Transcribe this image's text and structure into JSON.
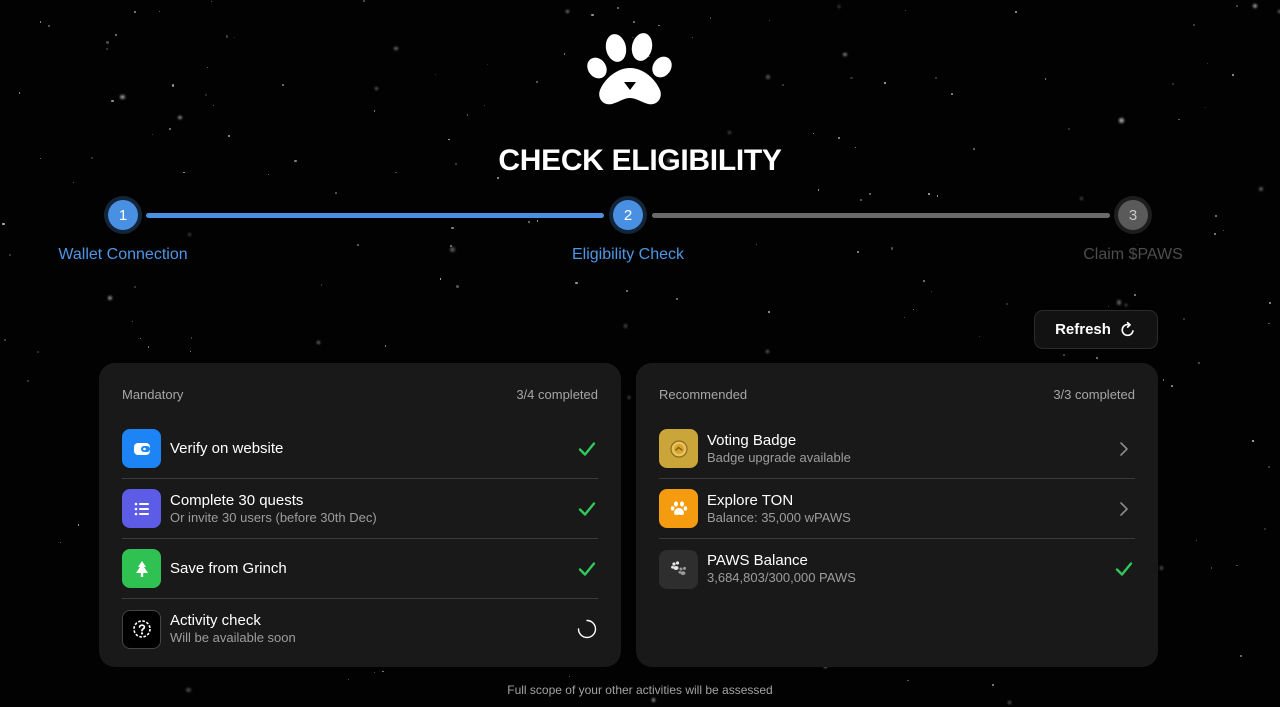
{
  "title": "CHECK ELIGIBILITY",
  "logo": {
    "icon": "paw-icon"
  },
  "steps": [
    {
      "number": "1",
      "label": "Wallet Connection",
      "state": "done"
    },
    {
      "number": "2",
      "label": "Eligibility Check",
      "state": "current"
    },
    {
      "number": "3",
      "label": "Claim $PAWS",
      "state": "pending"
    }
  ],
  "progress_fraction": 0.5,
  "refresh": {
    "label": "Refresh",
    "icon": "refresh-icon"
  },
  "mandatory": {
    "heading": "Mandatory",
    "count": "3/4 completed",
    "items": [
      {
        "title": "Verify on website",
        "subtitle": "",
        "icon": "wallet-icon",
        "color": "#1d84f5",
        "status": "done"
      },
      {
        "title": "Complete 30 quests",
        "subtitle": "Or invite 30 users (before 30th Dec)",
        "icon": "list-icon",
        "color": "#5c5ce6",
        "status": "done"
      },
      {
        "title": "Save from Grinch",
        "subtitle": "",
        "icon": "tree-icon",
        "color": "#2fc152",
        "status": "done"
      },
      {
        "title": "Activity check",
        "subtitle": "Will be available soon",
        "icon": "question-icon",
        "color": "#000000",
        "status": "loading"
      }
    ]
  },
  "recommended": {
    "heading": "Recommended",
    "count": "3/3 completed",
    "items": [
      {
        "title": "Voting Badge",
        "subtitle": "Badge upgrade available",
        "icon": "badge-icon",
        "color": "#c9a53a",
        "status": "chevron"
      },
      {
        "title": "Explore TON",
        "subtitle": "Balance: 35,000 wPAWS",
        "icon": "paw-icon",
        "color": "#f59b0f",
        "status": "chevron"
      },
      {
        "title": "PAWS Balance",
        "subtitle": "3,684,803/300,000 PAWS",
        "icon": "paws-icon",
        "color": "#2e2e2e",
        "status": "done"
      }
    ]
  },
  "footer": "Full scope of your other activities will be assessed",
  "colors": {
    "accent": "#4a90e2",
    "success": "#30c85a",
    "card": "#191919"
  }
}
